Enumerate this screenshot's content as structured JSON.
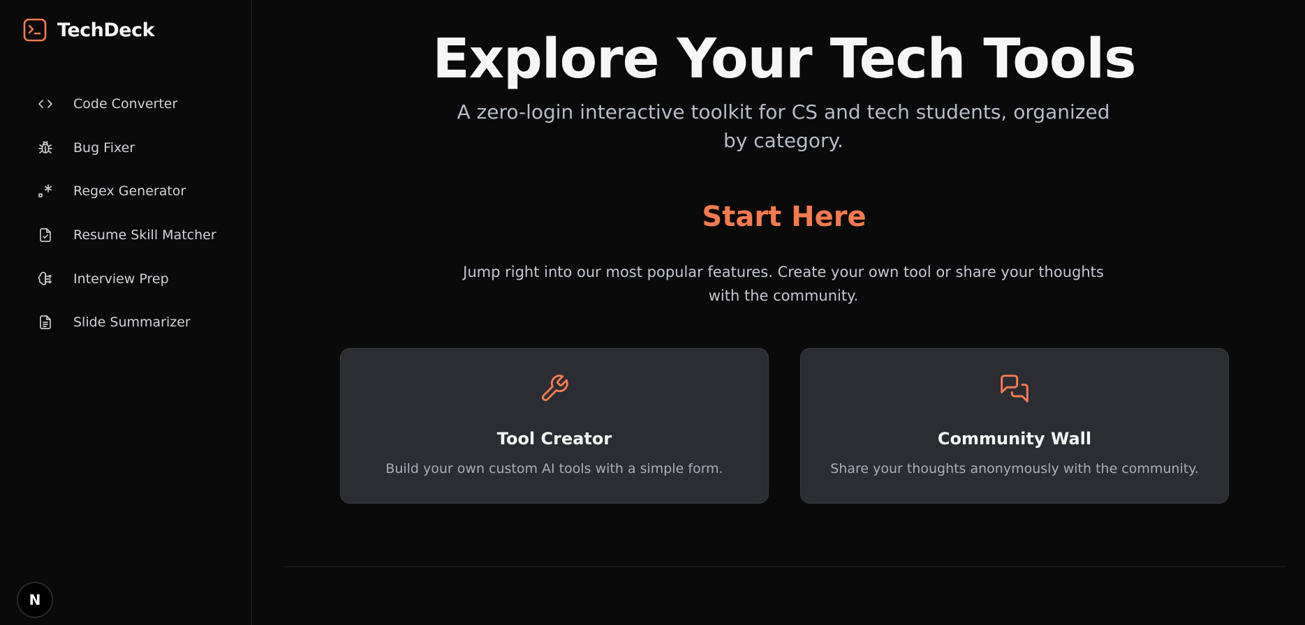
{
  "brand": {
    "name": "TechDeck",
    "logo_icon": "terminal-icon",
    "accent_color": "#f47b4e"
  },
  "sidebar": {
    "items": [
      {
        "label": "Code Converter",
        "icon": "code-icon"
      },
      {
        "label": "Bug Fixer",
        "icon": "bug-icon"
      },
      {
        "label": "Regex Generator",
        "icon": "regex-icon"
      },
      {
        "label": "Resume Skill Matcher",
        "icon": "file-check-icon"
      },
      {
        "label": "Interview Prep",
        "icon": "brain-icon"
      },
      {
        "label": "Slide Summarizer",
        "icon": "document-icon"
      }
    ],
    "badge_letter": "N"
  },
  "hero": {
    "title": "Explore Your Tech Tools",
    "subtitle": "A zero-login interactive toolkit for CS and tech students, organized by category."
  },
  "start": {
    "title": "Start Here",
    "subtitle": "Jump right into our most popular features. Create your own tool or share your thoughts with the community."
  },
  "cards": [
    {
      "title": "Tool Creator",
      "description": "Build your own custom AI tools with a simple form.",
      "icon": "wrench-icon"
    },
    {
      "title": "Community Wall",
      "description": "Share your thoughts anonymously with the community.",
      "icon": "chat-icon"
    }
  ],
  "colors": {
    "background": "#0a0a0a",
    "card": "#2b2d33",
    "accent": "#f47b4e"
  }
}
